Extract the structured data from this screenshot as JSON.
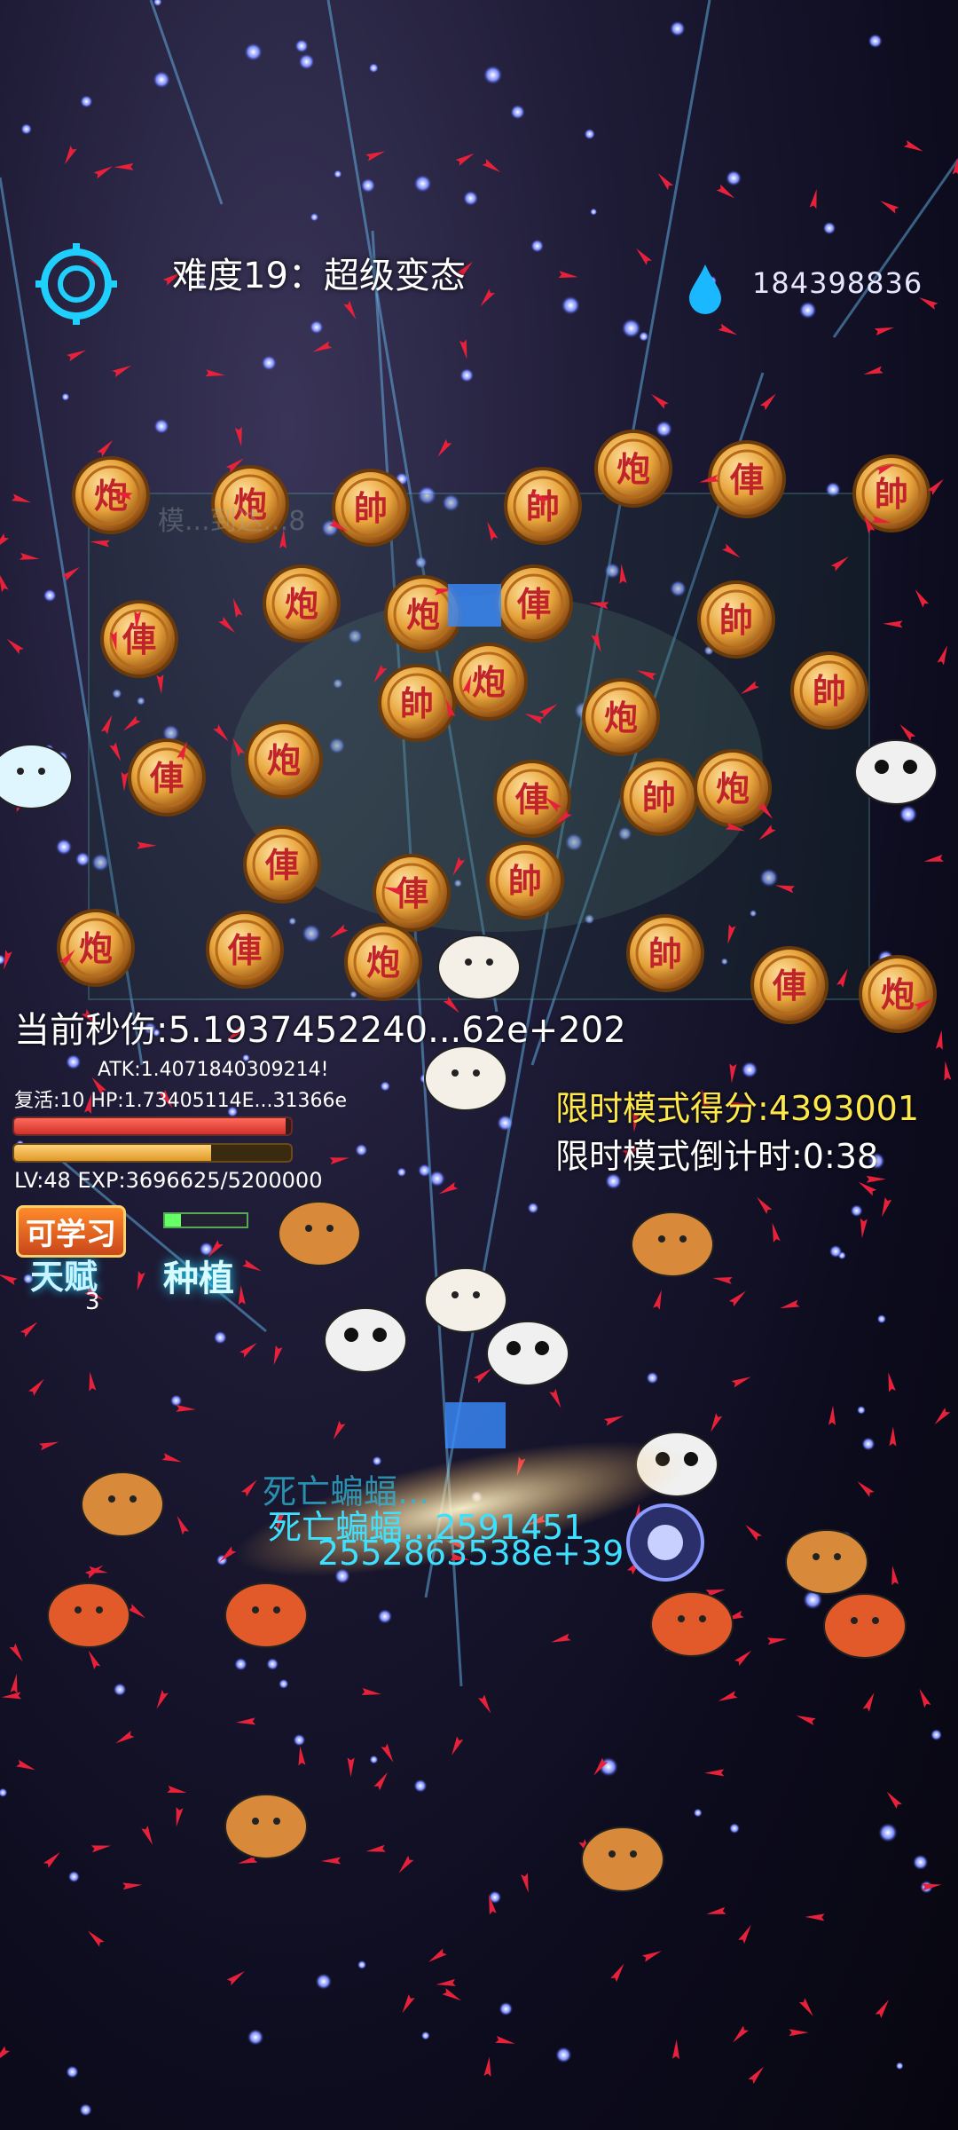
{
  "hud": {
    "difficulty": "难度19：超级变态",
    "currency": "184398836",
    "dps": "当前秒伤:5.1937452240...62e+202",
    "atk": "ATK:1.4071840309214!",
    "revive_hp": "复活:10 HP:1.73405114E...31366e",
    "lv_exp": "LV:48  EXP:3696625/5200000",
    "timed_score": "限时模式得分:4393001",
    "timed_countdown": "限时模式倒计时:0:38",
    "learnable": "可学习",
    "talent": "天赋",
    "talent_count": "3",
    "plant": "种植",
    "hp_fraction": 0.98,
    "exp_fraction": 0.71,
    "plant_progress": 0.2
  },
  "damage_texts": [
    "死亡蝙蝠...",
    "死亡蝙蝠...2591451",
    "2552863538e+39"
  ],
  "faded_label": "模...到达...8",
  "chess_pieces": [
    "炮",
    "炮",
    "帥",
    "帥",
    "炮",
    "俥",
    "帥",
    "俥",
    "炮",
    "炮",
    "俥",
    "帥",
    "炮",
    "帥",
    "帥",
    "俥",
    "炮",
    "俥",
    "帥",
    "炮",
    "俥",
    "俥",
    "帥",
    "炮",
    "俥",
    "炮",
    "帥",
    "俥",
    "炮",
    "炮"
  ],
  "colors": {
    "accent_cyan": "#1fd0ff",
    "score_yellow": "#ffe84a",
    "hp_red": "#d0322a",
    "exp_orange": "#e09a2a",
    "projectile_red": "#e8213a",
    "chess_gold": "#e7a33a"
  },
  "icons": {
    "settings": "target-gear-icon",
    "currency": "water-drop-icon",
    "talent": "talent-icon",
    "plant": "plant-icon"
  }
}
